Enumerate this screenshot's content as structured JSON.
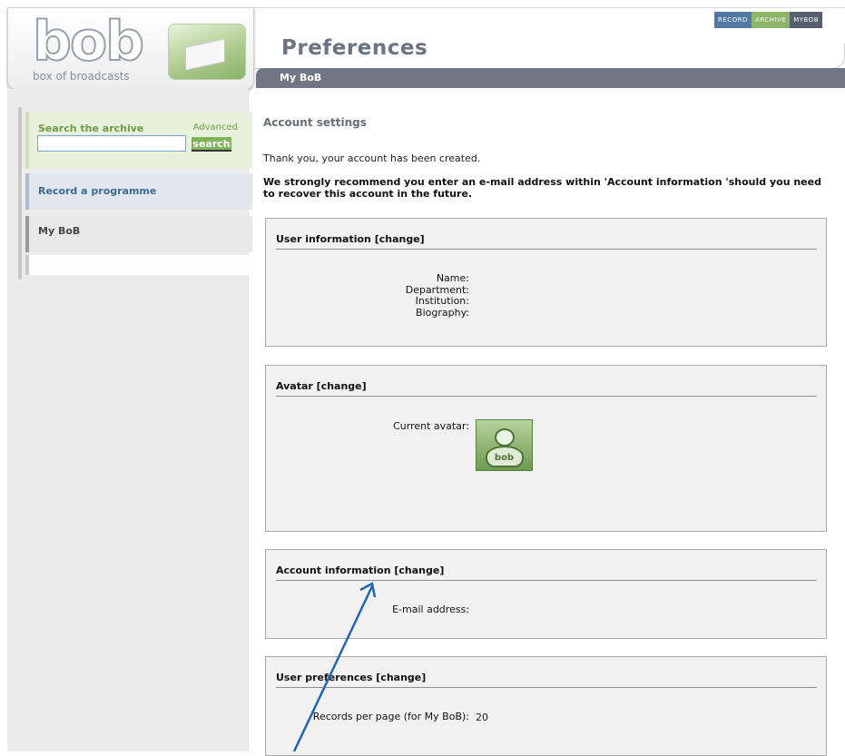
{
  "brand": {
    "logo_text": "bob",
    "tagline": "box of broadcasts"
  },
  "top_tabs": [
    "RECORD",
    "ARCHIVE",
    "MYBOB"
  ],
  "header": {
    "title": "Preferences",
    "subnav_label": "My BoB"
  },
  "sidebar": {
    "search_title": "Search the archive",
    "advanced_label": "Advanced",
    "search_value": "",
    "search_button": "search",
    "record_label": "Record a programme",
    "mybob_label": "My BoB"
  },
  "main": {
    "section_title": "Account settings",
    "thanks": "Thank you, your account has been created.",
    "recommend": "We strongly recommend you enter an e-mail address within 'Account information 'should you need to recover this account in the future.",
    "user_info": {
      "title": "User information [change]",
      "fields": [
        "Name:",
        "Department:",
        "Institution:",
        "Biography:"
      ]
    },
    "avatar": {
      "title": "Avatar [change]",
      "label": "Current avatar:",
      "image_text": "bob"
    },
    "account": {
      "title": "Account information [change]",
      "email_label": "E-mail address:"
    },
    "prefs": {
      "title": "User preferences [change]",
      "records_label": "Records per page (for My BoB):",
      "records_value": "20"
    }
  },
  "colors": {
    "accent_green": "#7fb357",
    "nav_grey": "#6e7782",
    "record_blue": "#5279a3",
    "annotation_arrow": "#1f66b8"
  }
}
